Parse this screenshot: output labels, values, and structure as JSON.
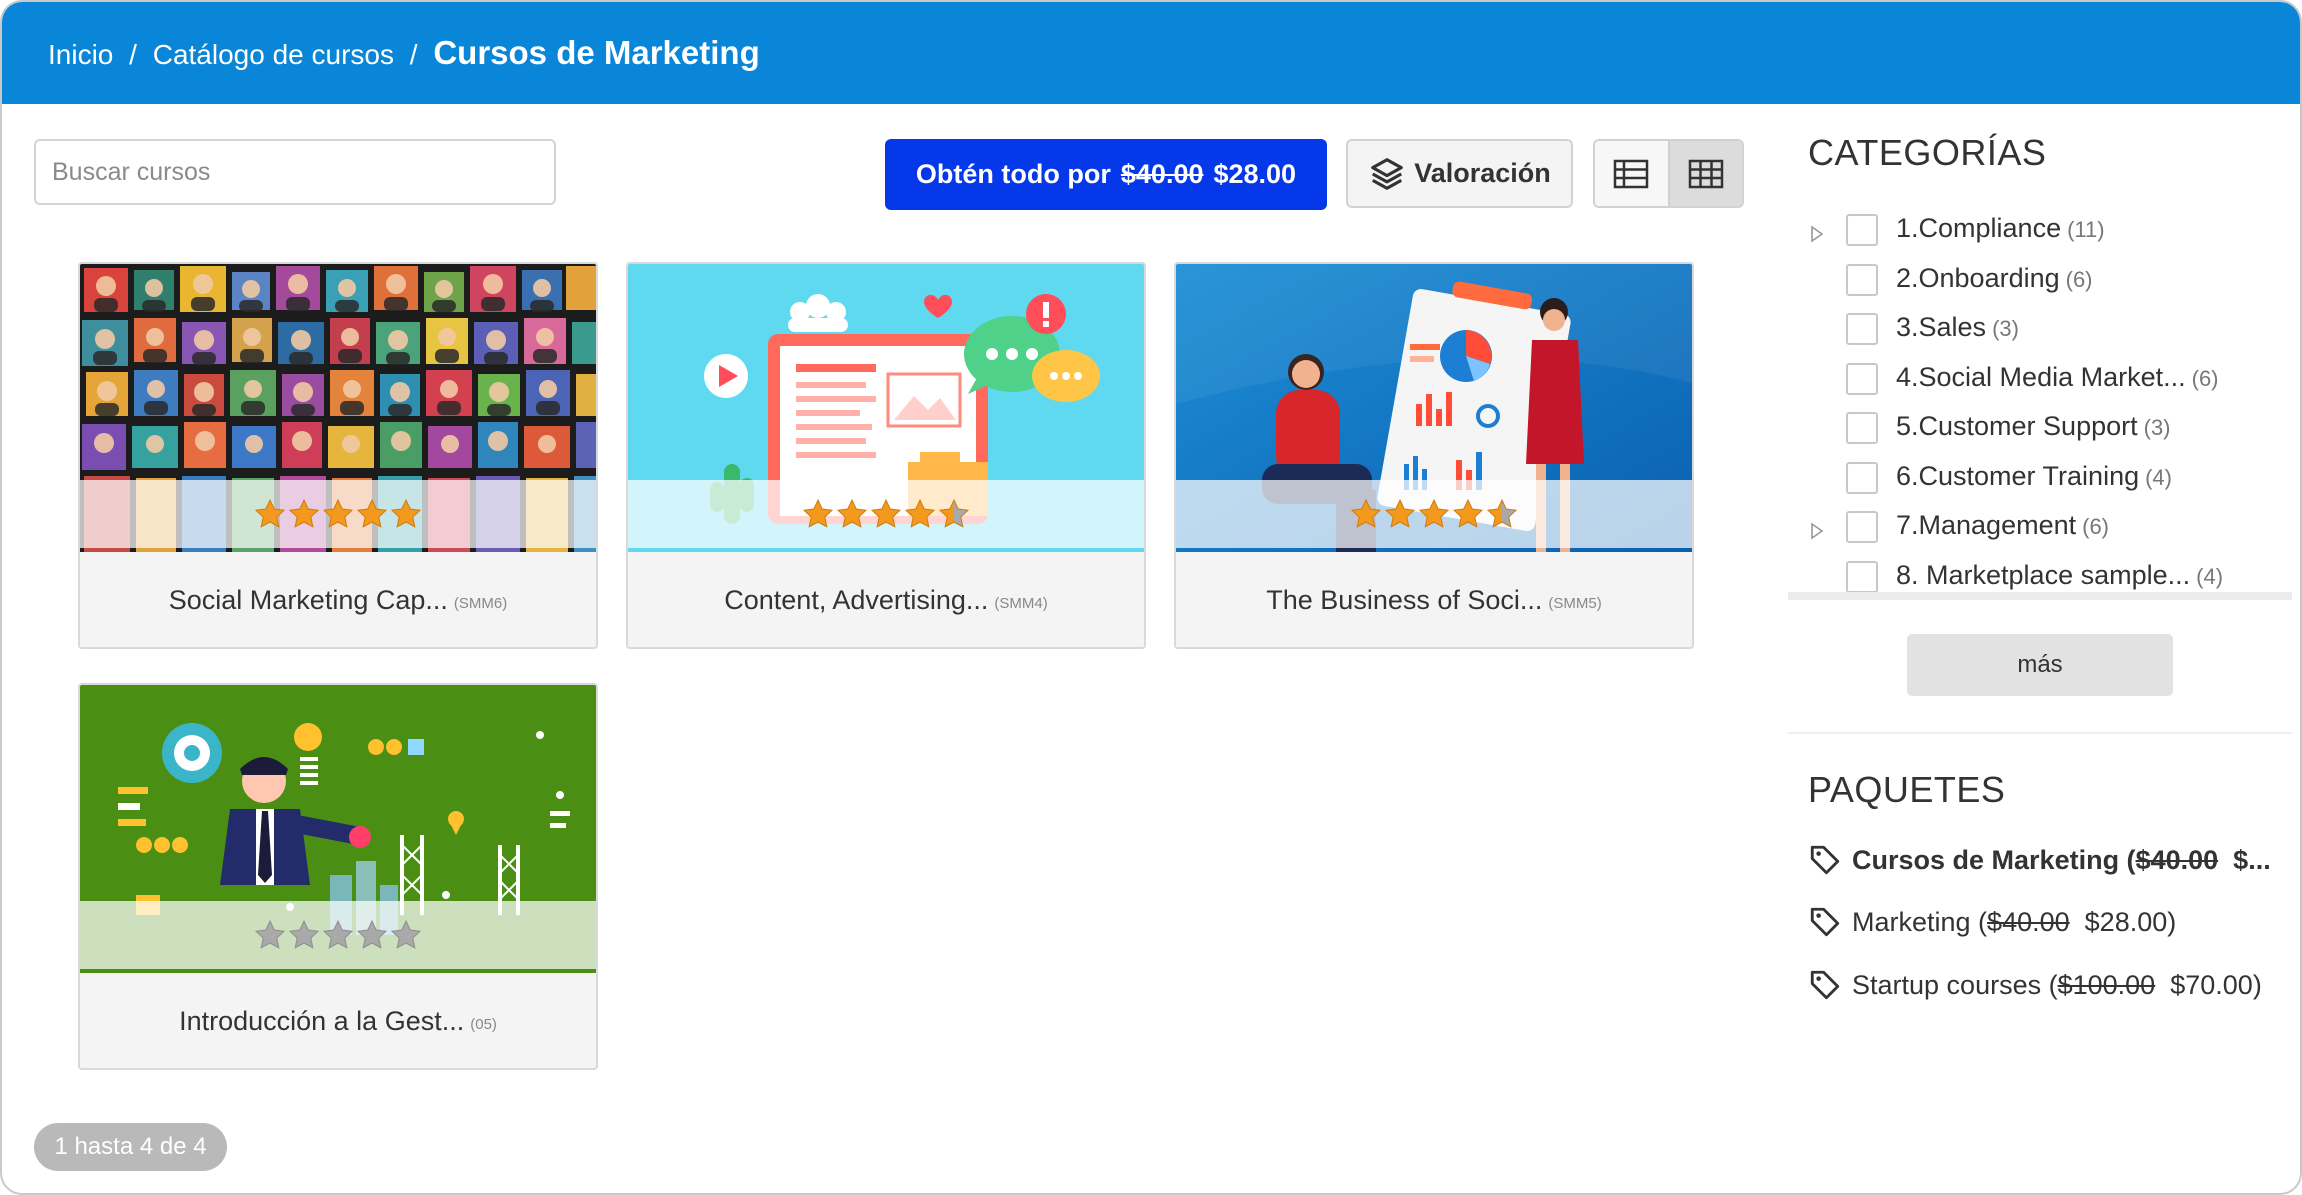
{
  "breadcrumb": {
    "home": "Inicio",
    "catalog": "Catálogo de cursos",
    "current": "Cursos de Marketing",
    "separator": "/"
  },
  "search": {
    "placeholder": "Buscar cursos"
  },
  "bundle_button": {
    "prefix": "Obtén todo por",
    "old_price": "$40.00",
    "new_price": "$28.00"
  },
  "rating_button": {
    "label": "Valoración"
  },
  "view_toggle": {
    "active": "grid"
  },
  "courses": [
    {
      "title": "Social Marketing Cap...",
      "code": "(SMM6)",
      "rating": 5
    },
    {
      "title": "Content, Advertising...",
      "code": "(SMM4)",
      "rating": 4.5
    },
    {
      "title": "The Business of Soci...",
      "code": "(SMM5)",
      "rating": 4.5
    },
    {
      "title": "Introducción a la Gest...",
      "code": "(05)",
      "rating": 0
    }
  ],
  "pager": {
    "text": "1 hasta 4 de 4"
  },
  "categories": {
    "title": "CATEGORÍAS",
    "items": [
      {
        "label": "1.Compliance",
        "count": "(11)",
        "expandable": true
      },
      {
        "label": "2.Onboarding",
        "count": "(6)",
        "expandable": false
      },
      {
        "label": "3.Sales",
        "count": "(3)",
        "expandable": false
      },
      {
        "label": "4.Social Media Market...",
        "count": "(6)",
        "expandable": false
      },
      {
        "label": "5.Customer Support",
        "count": "(3)",
        "expandable": false
      },
      {
        "label": "6.Customer Training",
        "count": "(4)",
        "expandable": false
      },
      {
        "label": "7.Management",
        "count": "(6)",
        "expandable": true
      },
      {
        "label": "8. Marketplace sample...",
        "count": "(4)",
        "expandable": false
      }
    ],
    "more_label": "más"
  },
  "packages": {
    "title": "PAQUETES",
    "items": [
      {
        "name": "Cursos de Marketing (",
        "old_price": "$40.00",
        "new_price": "$...",
        "suffix": ""
      },
      {
        "name": "Marketing (",
        "old_price": "$40.00",
        "new_price": "$28.00",
        "suffix": ")"
      },
      {
        "name": "Startup courses (",
        "old_price": "$100.00",
        "new_price": "$70.00",
        "suffix": ")"
      }
    ]
  },
  "colors": {
    "header": "#0a86d8",
    "bundle_button": "#0538e8",
    "star": "#f39a1e",
    "star_empty": "#a9a9a9"
  }
}
